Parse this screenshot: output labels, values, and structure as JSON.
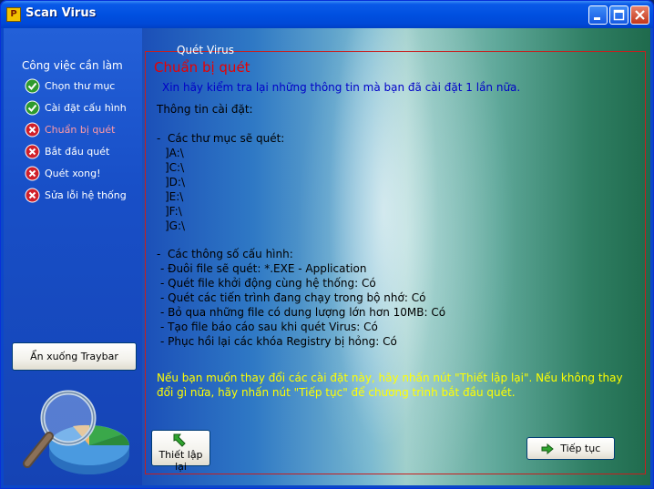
{
  "window": {
    "title": "Scan Virus",
    "app_icon_glyph": "P"
  },
  "sidebar": {
    "heading": "Công việc cần làm",
    "tasks": [
      {
        "label": "Chọn thư mục",
        "status": "done",
        "icon": "check-circle-icon"
      },
      {
        "label": "Cài đặt cấu hình",
        "status": "done",
        "icon": "check-circle-icon"
      },
      {
        "label": "Chuẩn bị quét",
        "status": "current",
        "icon": "x-circle-icon"
      },
      {
        "label": "Bắt đầu quét",
        "status": "pending",
        "icon": "x-circle-icon"
      },
      {
        "label": "Quét xong!",
        "status": "pending",
        "icon": "x-circle-icon"
      },
      {
        "label": "Sửa lỗi hệ thống",
        "status": "pending",
        "icon": "x-circle-icon"
      }
    ],
    "tray_button": "Ẩn xuống Traybar"
  },
  "main": {
    "group_title": "Quét Virus",
    "heading": "Chuẩn bị quét",
    "intro": "Xin hãy kiểm tra lại những thông tin mà bạn đã cài đặt 1 lần nữa.",
    "settings_title": "Thông tin cài đặt:",
    "folders_title": "-  Các thư mục sẽ quét:",
    "folders": [
      "]A:\\",
      "]C:\\",
      "]D:\\",
      "]E:\\",
      "]F:\\",
      "]G:\\"
    ],
    "config_title": "-  Các thông số cấu hình:",
    "config": [
      "- Đuôi file sẽ quét: *.EXE - Application",
      "- Quét file khởi động cùng hệ thống: Có",
      "- Quét các tiến trình đang chạy trong bộ nhớ: Có",
      "- Bỏ qua những file có dung lượng lớn hơn 10MB: Có",
      "- Tạo file báo cáo sau khi quét Virus: Có",
      "- Phục hồi lại các khóa Registry bị hỏng: Có"
    ],
    "warning": "Nếu bạn muốn thay đổi các cài đặt này, hãy nhấn nút \"Thiết lập lại\". Nếu không thay đổi gì nữa, hãy nhấn nút \"Tiếp tục\" để chương trình bắt đầu quét.",
    "reset_button": "Thiết lập lại",
    "next_button": "Tiếp tục"
  },
  "colors": {
    "heading": "#e80000",
    "intro": "#0000c8",
    "warning": "#ffff00",
    "done_icon": "#2e9a2e",
    "pending_icon": "#d0202a"
  }
}
